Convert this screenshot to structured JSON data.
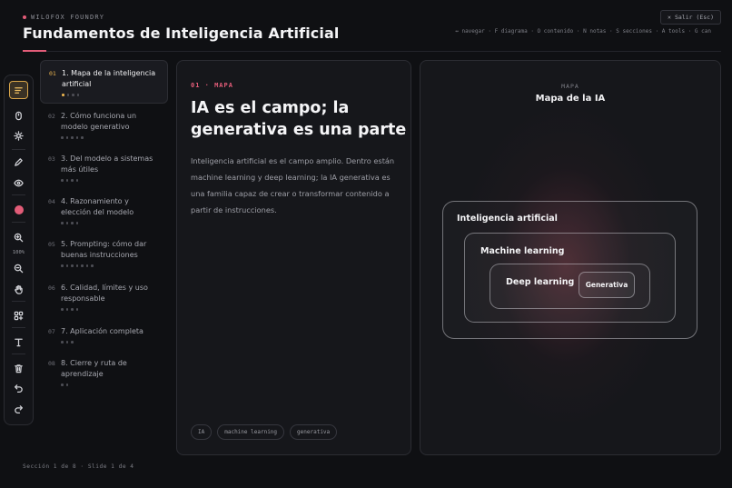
{
  "header": {
    "brand": "WILOFOX FOUNDRY",
    "title": "Fundamentos de Inteligencia Artificial",
    "exit_label": "Salir (Esc)",
    "shortcuts": "↔ navegar · F diagrama · O contenido · N notas · S secciones · A tools · G can"
  },
  "toolbar": {
    "tools": [
      "menu-icon",
      "mouse-icon",
      "sun-icon",
      "pencil-icon",
      "eye-icon",
      "color-swatch",
      "zoom-in-icon",
      "zoom-out-icon",
      "hand-icon",
      "grid-icon",
      "text-icon",
      "trash-icon",
      "undo-icon",
      "redo-icon"
    ],
    "zoom_level": "100%",
    "pen_color": "#e25c78"
  },
  "nav": {
    "items": [
      {
        "num": "01",
        "label": "1. Mapa de la inteligencia artificial",
        "slides": 4,
        "current_slide": 1
      },
      {
        "num": "02",
        "label": "2. Cómo funciona un modelo generativo",
        "slides": 5
      },
      {
        "num": "03",
        "label": "3. Del modelo a sistemas más útiles",
        "slides": 4
      },
      {
        "num": "04",
        "label": "4. Razonamiento y elección del modelo",
        "slides": 4
      },
      {
        "num": "05",
        "label": "5. Prompting: cómo dar buenas instrucciones",
        "slides": 7
      },
      {
        "num": "06",
        "label": "6. Calidad, límites y uso responsable",
        "slides": 4
      },
      {
        "num": "07",
        "label": "7. Aplicación completa",
        "slides": 3
      },
      {
        "num": "08",
        "label": "8. Cierre y ruta de aprendizaje",
        "slides": 2
      }
    ]
  },
  "slide": {
    "kicker": "01 · MAPA",
    "heading": "IA es el campo; la generativa es una parte",
    "body": "Inteligencia artificial es el campo amplio. Dentro están machine learning y deep learning; la IA generativa es una familia capaz de crear o transformar contenido a partir de instrucciones.",
    "tags": [
      "IA",
      "machine learning",
      "generativa"
    ]
  },
  "diagram": {
    "kicker": "MAPA",
    "title": "Mapa de la IA",
    "levels": [
      "Inteligencia artificial",
      "Machine learning",
      "Deep learning",
      "Generativa"
    ]
  },
  "footer": {
    "status": "Sección 1 de 8 · Slide 1 de 4"
  },
  "colors": {
    "accent": "#e25c78",
    "active": "#e8b24e",
    "background": "#0f1013"
  }
}
